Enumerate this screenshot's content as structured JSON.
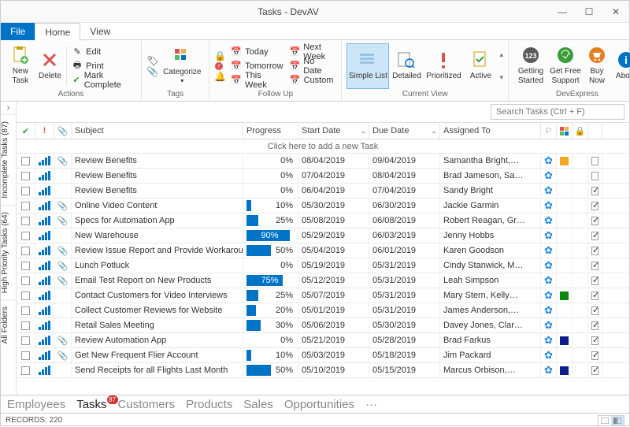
{
  "window": {
    "title": "Tasks - DevAV"
  },
  "ribbon_tabs": {
    "file": "File",
    "home": "Home",
    "view": "View"
  },
  "ribbon": {
    "actions": {
      "label": "Actions",
      "new_task": "New\nTask",
      "delete": "Delete",
      "edit": "Edit",
      "print": "Print",
      "mark_complete": "Mark Complete"
    },
    "tags": {
      "label": "Tags",
      "categorize": "Categorize"
    },
    "followup": {
      "label": "Follow Up",
      "today": "Today",
      "tomorrow": "Tomorrow",
      "this_week": "This Week",
      "next_week": "Next Week",
      "no_date": "No Date",
      "custom": "Custom"
    },
    "view": {
      "label": "Current View",
      "simple_list": "Simple List",
      "detailed": "Detailed",
      "prioritized": "Prioritized",
      "active": "Active"
    },
    "devexpress": {
      "label": "DevExpress",
      "getting_started": "Getting\nStarted",
      "get_free_support": "Get Free\nSupport",
      "buy_now": "Buy\nNow",
      "about": "About"
    }
  },
  "search": {
    "placeholder": "Search Tasks (Ctrl + F)"
  },
  "side_tabs": {
    "incomplete": "Incomplete Tasks (87)",
    "high_priority": "High Priority Tasks (64)",
    "all_folders": "All Folders"
  },
  "columns": {
    "subject": "Subject",
    "progress": "Progress",
    "start": "Start Date",
    "due": "Due Date",
    "assigned": "Assigned To"
  },
  "new_row": "Click here to add a new Task",
  "rows": [
    {
      "clip": true,
      "subject": "Review Benefits",
      "progress": 0,
      "start": "08/04/2019",
      "due": "09/04/2019",
      "assigned": "Samantha Bright,…",
      "cat": "#f5a623",
      "done": false
    },
    {
      "clip": false,
      "subject": "Review Benefits",
      "progress": 0,
      "start": "07/04/2019",
      "due": "08/04/2019",
      "assigned": "Brad Jameson, Sa…",
      "cat": "",
      "done": false
    },
    {
      "clip": false,
      "subject": "Review Benefits",
      "progress": 0,
      "start": "06/04/2019",
      "due": "07/04/2019",
      "assigned": "Sandy Bright",
      "cat": "",
      "done": true
    },
    {
      "clip": true,
      "subject": "Online Video Content",
      "progress": 10,
      "start": "05/30/2019",
      "due": "06/30/2019",
      "assigned": "Jackie Garmin",
      "cat": "",
      "done": true
    },
    {
      "clip": true,
      "subject": "Specs for Automation App",
      "progress": 25,
      "start": "05/08/2019",
      "due": "06/08/2019",
      "assigned": "Robert Reagan, Gr…",
      "cat": "",
      "done": true
    },
    {
      "clip": false,
      "subject": "New Warehouse",
      "progress": 90,
      "start": "05/29/2019",
      "due": "06/03/2019",
      "assigned": "Jenny Hobbs",
      "cat": "",
      "done": true
    },
    {
      "clip": true,
      "subject": "Review Issue Report and Provide Workarounds",
      "progress": 50,
      "start": "05/04/2019",
      "due": "06/01/2019",
      "assigned": "Karen Goodson",
      "cat": "",
      "done": true
    },
    {
      "clip": true,
      "subject": "Lunch Potluck",
      "progress": 0,
      "start": "05/19/2019",
      "due": "05/31/2019",
      "assigned": "Cindy Stanwick, M…",
      "cat": "",
      "done": true
    },
    {
      "clip": true,
      "subject": "Email Test Report on New Products",
      "progress": 75,
      "start": "05/12/2019",
      "due": "05/31/2019",
      "assigned": "Leah Simpson",
      "cat": "",
      "done": true
    },
    {
      "clip": false,
      "subject": "Contact Customers for Video Interviews",
      "progress": 25,
      "start": "05/07/2019",
      "due": "05/31/2019",
      "assigned": "Mary Stern, Kelly…",
      "cat": "#0a8a0a",
      "done": true
    },
    {
      "clip": false,
      "subject": "Collect Customer Reviews for Website",
      "progress": 20,
      "start": "05/01/2019",
      "due": "05/31/2019",
      "assigned": "James Anderson,…",
      "cat": "",
      "done": true
    },
    {
      "clip": false,
      "subject": "Retail Sales Meeting",
      "progress": 30,
      "start": "05/06/2019",
      "due": "05/30/2019",
      "assigned": "Davey Jones, Clar…",
      "cat": "",
      "done": true
    },
    {
      "clip": true,
      "subject": "Review Automation App",
      "progress": 0,
      "start": "05/21/2019",
      "due": "05/28/2019",
      "assigned": "Brad Farkus",
      "cat": "#0b1d8a",
      "done": true
    },
    {
      "clip": true,
      "subject": "Get New Frequent Flier Account",
      "progress": 10,
      "start": "05/03/2019",
      "due": "05/18/2019",
      "assigned": "Jim Packard",
      "cat": "",
      "done": true
    },
    {
      "clip": false,
      "subject": "Send Receipts for all Flights Last Month",
      "progress": 50,
      "start": "05/10/2019",
      "due": "05/15/2019",
      "assigned": "Marcus Orbison,…",
      "cat": "#0b1d8a",
      "done": true
    }
  ],
  "bottom_nav": {
    "employees": "Employees",
    "tasks": "Tasks",
    "tasks_badge": "87",
    "customers": "Customers",
    "products": "Products",
    "sales": "Sales",
    "opportunities": "Opportunities",
    "more": "···"
  },
  "status": {
    "records": "RECORDS: 220"
  }
}
